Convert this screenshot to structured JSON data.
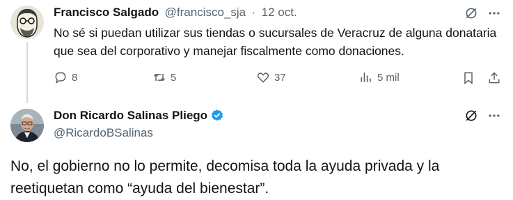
{
  "reply": {
    "author_name": "Francisco Salgado",
    "handle": "@francisco_sja",
    "separator": "·",
    "date": "12 oct.",
    "text": "No sé si puedan utilizar sus tiendas o sucursales de Veracruz de alguna donataria que sea del corporativo y manejar fiscalmente como donaciones.",
    "actions": {
      "replies": "8",
      "reposts": "5",
      "likes": "37",
      "views": "5 mil"
    }
  },
  "main": {
    "author_name": "Don Ricardo Salinas Pliego",
    "handle": "@RicardoBSalinas",
    "verified": true,
    "text": "No, el gobierno no lo permite, decomisa toda la ayuda privada y la reetiquetan como “ayuda del bienestar”."
  },
  "colors": {
    "text": "#0f1419",
    "muted": "#536471",
    "verified": "#1d9bf0",
    "divider": "#cfd9de"
  },
  "icons": [
    "grok-icon",
    "more-icon",
    "reply-icon",
    "repost-icon",
    "like-icon",
    "views-icon",
    "bookmark-icon",
    "share-icon",
    "verified-badge-icon"
  ]
}
